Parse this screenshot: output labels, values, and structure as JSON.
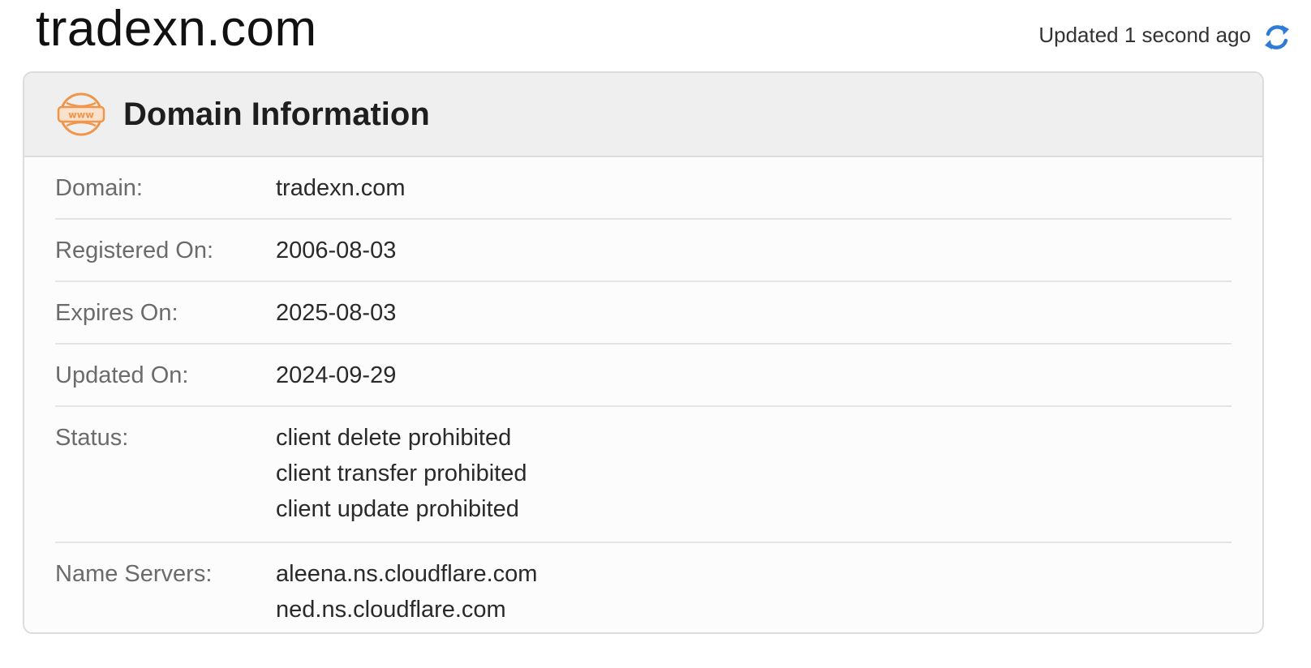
{
  "header": {
    "site_title": "tradexn.com",
    "updated_text": "Updated 1 second ago",
    "refresh_icon": "refresh-icon"
  },
  "card": {
    "title": "Domain Information",
    "icon": "www-globe-icon",
    "accent_color": "#f0954a"
  },
  "rows": {
    "domain": {
      "label": "Domain:",
      "value": "tradexn.com"
    },
    "registered": {
      "label": "Registered On:",
      "value": "2006-08-03"
    },
    "expires": {
      "label": "Expires On:",
      "value": "2025-08-03"
    },
    "updated": {
      "label": "Updated On:",
      "value": "2024-09-29"
    },
    "status": {
      "label": "Status:",
      "values": [
        "client delete prohibited",
        "client transfer prohibited",
        "client update prohibited"
      ]
    },
    "name_servers": {
      "label": "Name Servers:",
      "values": [
        "aleena.ns.cloudflare.com",
        "ned.ns.cloudflare.com"
      ]
    }
  }
}
